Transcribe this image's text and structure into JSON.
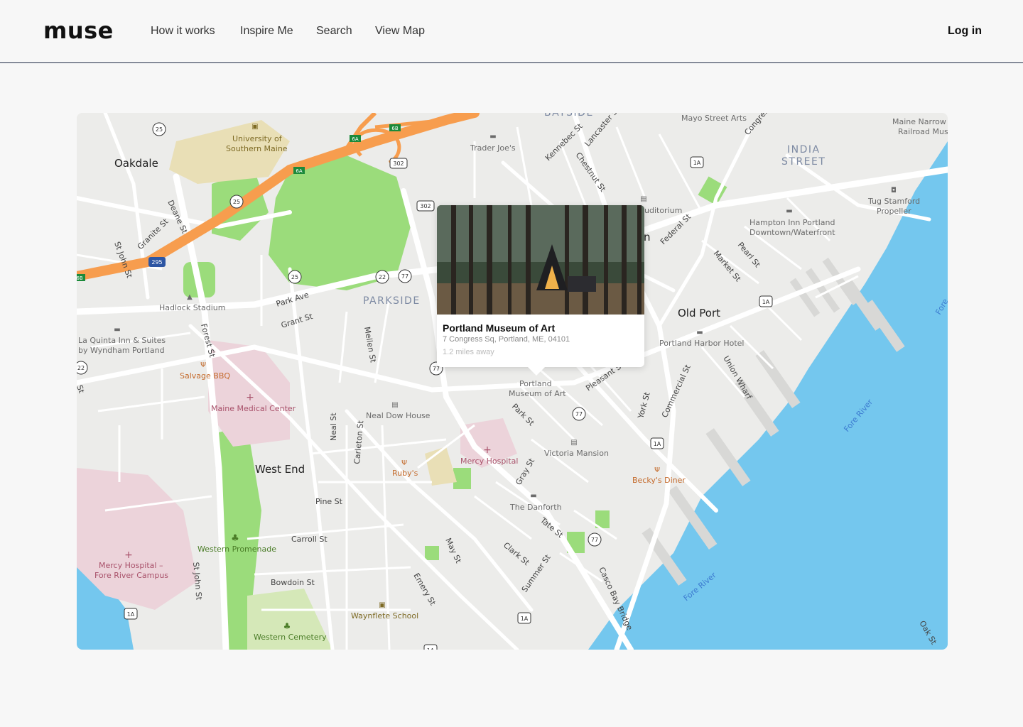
{
  "header": {
    "logo": "muse",
    "nav": [
      "How it works",
      "Inspire Me",
      "Search",
      "View Map"
    ],
    "login": "Log in"
  },
  "colors": {
    "water": "#74c7ee",
    "park": "#9bdc7b",
    "highway": "#f79d4e",
    "road": "#ffffff",
    "land": "#ececea",
    "campus": "#e9dfb6",
    "hospital": "#ecd3da",
    "header_rule": "#1f2a44"
  },
  "map": {
    "neighborhoods": [
      "Oakdale",
      "West End",
      "Old Port",
      "PARKSIDE",
      "INDIA",
      "STREET",
      "BAYSIDE"
    ],
    "places": [
      "University of",
      "Southern Maine",
      "Trader Joe's",
      "Mayo Street Arts",
      "Maine Narrow G",
      "Railroad Muse",
      "Hadlock Stadium",
      "La Quinta Inn & Suites",
      "by Wyndham Portland",
      "Salvage BBQ",
      "Maine Medical Center",
      "Neal Dow House",
      "Portland",
      "Museum of Art",
      "Mercy Hospital",
      "Ruby's",
      "Victoria Mansion",
      "Portland Harbor Hotel",
      "Becky's Diner",
      "The Danforth",
      "Western Promenade",
      "Mercy Hospital –",
      "Fore River Campus",
      "Waynflete School",
      "Western Cemetery",
      "Hampton Inn Portland",
      "Downtown/Waterfront",
      "Tug Stamford",
      "Propeller",
      "uditorium",
      "n"
    ],
    "streets": [
      "Deane St",
      "Granite St",
      "St John St",
      "Park Ave",
      "Grant St",
      "Mellen St",
      "Forest St",
      "Kennebec St",
      "Lancaster St",
      "Chestnut St",
      "Federal St",
      "Market St",
      "Pearl St",
      "Congress",
      "Pleasant St",
      "York St",
      "Commercial St",
      "Union Wharf",
      "Park St",
      "Neal St",
      "Carleton St",
      "Pine St",
      "Carroll St",
      "Bowdoin St",
      "May St",
      "Emery St",
      "Gray St",
      "Tate St",
      "Clark St",
      "Summer St",
      "Casco Bay Bridge",
      "Oak St",
      "St John St",
      "St"
    ],
    "water": [
      "Fore River",
      "Fore River",
      "Fore"
    ],
    "shields": [
      "25",
      "25",
      "25",
      "22",
      "77",
      "77",
      "77",
      "302",
      "302",
      "1A",
      "1A",
      "1A",
      "1A",
      "1A",
      "1A",
      "295",
      "6A",
      "6A",
      "6B",
      "6B",
      "22",
      "77"
    ]
  },
  "popup": {
    "title": "Portland Museum of Art",
    "address": "7 Congress Sq, Portland, ME, 04101",
    "distance": "1.2 miles away"
  }
}
